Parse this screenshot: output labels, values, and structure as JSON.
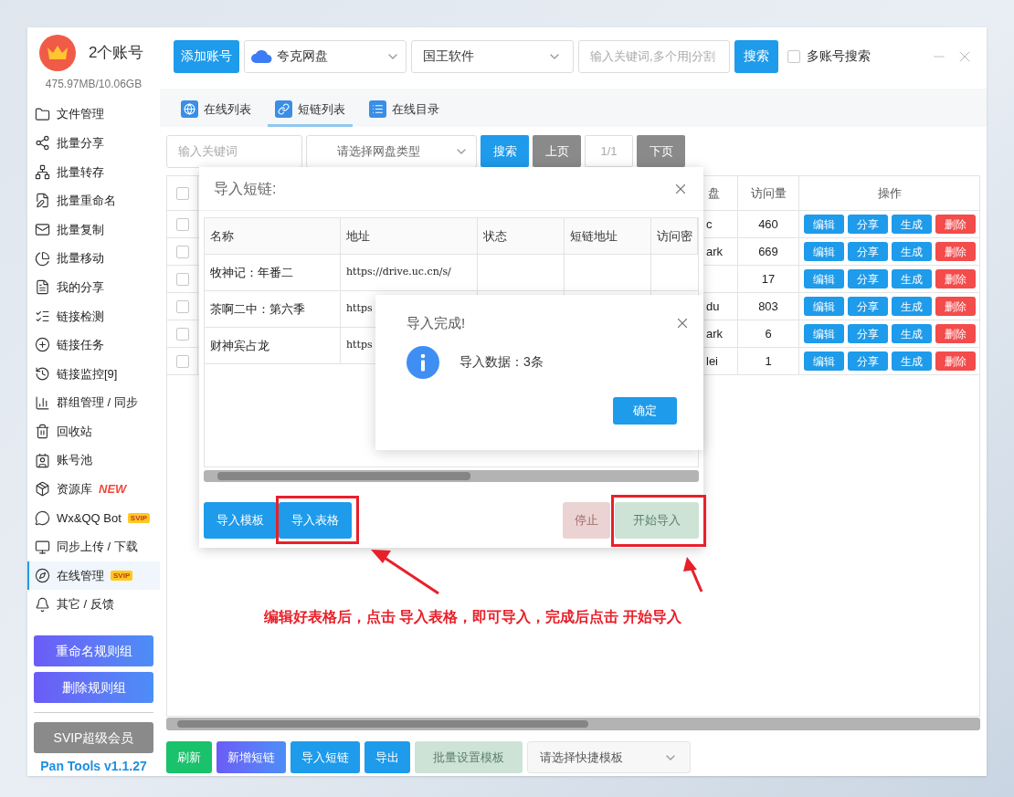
{
  "header": {
    "account_count": "2个账号",
    "storage": "475.97MB/10.06GB",
    "add_account_button": "添加账号",
    "drive_select": "夸克网盘",
    "software_select": "国王软件",
    "keyword_placeholder": "输入关键词,多个用|分割",
    "search_button": "搜索",
    "multi_account": {
      "label": "多账号搜索",
      "checked": false
    }
  },
  "sidebar": {
    "items": [
      {
        "label": "文件管理",
        "selected": false
      },
      {
        "label": "批量分享",
        "selected": false
      },
      {
        "label": "批量转存",
        "selected": false
      },
      {
        "label": "批量重命名",
        "selected": false
      },
      {
        "label": "批量复制",
        "selected": false
      },
      {
        "label": "批量移动",
        "selected": false
      },
      {
        "label": "我的分享",
        "selected": false
      },
      {
        "label": "链接检测",
        "selected": false
      },
      {
        "label": "链接任务",
        "selected": false
      },
      {
        "label": "链接监控[9]",
        "selected": false
      },
      {
        "label": "群组管理 / 同步",
        "selected": false
      },
      {
        "label": "回收站",
        "selected": false
      },
      {
        "label": "账号池",
        "selected": false
      },
      {
        "label": "资源库",
        "selected": false,
        "badge": {
          "text": "NEW",
          "kind": "new"
        }
      },
      {
        "label": "Wx&QQ Bot",
        "selected": false,
        "badge": {
          "text": "SVIP",
          "kind": "svip"
        }
      },
      {
        "label": "同步上传 / 下载",
        "selected": false
      },
      {
        "label": "在线管理",
        "selected": true,
        "badge": {
          "text": "SVIP",
          "kind": "svip"
        }
      },
      {
        "label": "其它 / 反馈",
        "selected": false
      }
    ],
    "rule_buttons": [
      "重命名规则组",
      "删除规则组"
    ],
    "svip_button": "SVIP超级会员",
    "version": "Pan Tools v1.1.27"
  },
  "tabs": [
    {
      "label": "在线列表",
      "selected": false
    },
    {
      "label": "短链列表",
      "selected": true
    },
    {
      "label": "在线目录",
      "selected": false
    }
  ],
  "filter": {
    "keyword_placeholder": "输入关键词",
    "type_placeholder": "请选择网盘类型",
    "search_button": "搜索",
    "prev_button": "上页",
    "page": "1/1",
    "next_button": "下页"
  },
  "table": {
    "header_checked": false,
    "columns": [
      "盘",
      "访问量",
      "操作"
    ],
    "rows": [
      {
        "checked": false,
        "column_2": "c",
        "visits": "460",
        "actions": [
          {
            "label": "编辑",
            "kind": "primary"
          },
          {
            "label": "分享",
            "kind": "primary"
          },
          {
            "label": "生成",
            "kind": "primary"
          },
          {
            "label": "删除",
            "kind": "danger"
          }
        ]
      },
      {
        "checked": false,
        "column_2": "ark",
        "visits": "669",
        "actions": [
          {
            "label": "编辑",
            "kind": "primary"
          },
          {
            "label": "分享",
            "kind": "primary"
          },
          {
            "label": "生成",
            "kind": "primary"
          },
          {
            "label": "删除",
            "kind": "danger"
          }
        ]
      },
      {
        "checked": false,
        "visits": "17",
        "actions": [
          {
            "label": "编辑",
            "kind": "primary"
          },
          {
            "label": "分享",
            "kind": "primary"
          },
          {
            "label": "生成",
            "kind": "primary"
          },
          {
            "label": "删除",
            "kind": "danger"
          }
        ]
      },
      {
        "checked": false,
        "column_2": "du",
        "visits": "803",
        "actions": [
          {
            "label": "编辑",
            "kind": "primary"
          },
          {
            "label": "分享",
            "kind": "primary"
          },
          {
            "label": "生成",
            "kind": "primary"
          },
          {
            "label": "删除",
            "kind": "danger"
          }
        ]
      },
      {
        "checked": false,
        "column_2": "ark",
        "visits": "6",
        "actions": [
          {
            "label": "编辑",
            "kind": "primary"
          },
          {
            "label": "分享",
            "kind": "primary"
          },
          {
            "label": "生成",
            "kind": "primary"
          },
          {
            "label": "删除",
            "kind": "danger"
          }
        ]
      },
      {
        "checked": false,
        "column_2": "lei",
        "visits": "1",
        "actions": [
          {
            "label": "编辑",
            "kind": "primary"
          },
          {
            "label": "分享",
            "kind": "primary"
          },
          {
            "label": "生成",
            "kind": "primary"
          },
          {
            "label": "删除",
            "kind": "danger"
          }
        ]
      }
    ]
  },
  "bottom_bar": {
    "buttons": [
      {
        "label": "刷新",
        "kind": "success",
        "disabled": false
      },
      {
        "label": "新增短链",
        "kind": "gradient",
        "disabled": false
      },
      {
        "label": "导入短链",
        "kind": "primary",
        "disabled": false
      },
      {
        "label": "导出",
        "kind": "primary",
        "disabled": false
      },
      {
        "label": "批量设置模板",
        "kind": "success",
        "disabled": true
      }
    ],
    "template_select": "请选择快捷模板"
  },
  "import_dialog": {
    "title": "导入短链:",
    "columns": [
      "名称",
      "地址",
      "状态",
      "短链地址",
      "访问密"
    ],
    "rows": [
      {
        "name": "牧神记：年番二",
        "url": "https://drive.uc.cn/s/"
      },
      {
        "name": "茶啊二中：第六季",
        "url": "https"
      },
      {
        "name": "财神宾占龙",
        "url": "https"
      }
    ],
    "left_buttons": [
      "导入模板",
      "导入表格"
    ],
    "stop_button": {
      "label": "停止",
      "disabled": true
    },
    "start_button": {
      "label": "开始导入",
      "disabled": true
    }
  },
  "alert": {
    "title": "导入完成!",
    "message": "导入数据：3条",
    "ok_button": "确定"
  },
  "annotation": {
    "caption": "编辑好表格后，点击 导入表格，即可导入，完成后点击 开始导入"
  }
}
